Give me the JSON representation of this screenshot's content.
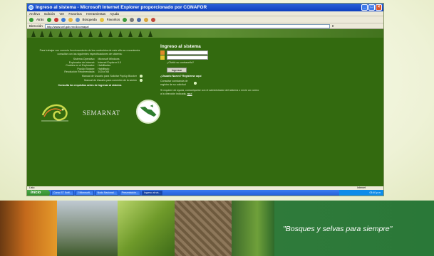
{
  "window": {
    "title": "Ingreso al sistema - Microsoft Internet Explorer proporcionado por CONAFOR"
  },
  "menubar": {
    "items": [
      "Archivo",
      "Edición",
      "Ver",
      "Favoritos",
      "Herramientas",
      "Ayuda"
    ]
  },
  "toolbar": {
    "back_label": "Atrás",
    "search_label": "Búsqueda",
    "favorites_label": "Favoritos"
  },
  "addressbar": {
    "label": "Dirección",
    "url": "http://www.cnf.gob.mx:8/comapa/",
    "go_label": "Ir"
  },
  "page": {
    "intro": "Para trabajar con correcto funcionamiento de los contenidos de este sitio se recomienda consultar con las siguientes especificaciones de sistema:",
    "requirements": [
      [
        "Sistema Operativo:",
        "Microsoft Windows"
      ],
      [
        "Explorador de Internet:",
        "Internet Explorer 6.0"
      ],
      [
        "Cookies en el Explorador:",
        "Habilitadas"
      ],
      [
        "PopUp Blocker:",
        "Habilitado"
      ],
      [
        "Resolución Recomendada:",
        "1024x768"
      ]
    ],
    "radio_1": "Manual de Usuario para Solicitar PopUp Blocker",
    "radio_2": "Manual de Usuario para conexión de la sesión",
    "warning": "Consulta los requisitos antes de ingresar al sistema",
    "semarnat_text": "SEMARNAT"
  },
  "login": {
    "title": "Ingreso al sistema",
    "user_value": "",
    "password_value": "",
    "forgot": "¿Olvidó su contraseña?",
    "submit": "Ingresar",
    "new_user_title": "¿Usuario Nuevo? Regístrese aquí",
    "new_user_text": "Consultar constancia de registro de su solicitud",
    "help_text": "Si requiere de ayuda, comuníquese con el administrador del sistema o envíe un correo a la dirección indicada.",
    "help_link": "aquí"
  },
  "statusbar": {
    "left": "Listo",
    "zone": "Internet"
  },
  "taskbar": {
    "start": "Inicio",
    "tasks": [
      "Curso ST Softl...",
      "2 Microsoft...",
      "Nodo Nacional...",
      "Presentación...",
      "Ingreso al sis..."
    ],
    "clock": "03:40 p.m."
  },
  "slide": {
    "motto": "\"Bosques y selvas para siempre\""
  }
}
